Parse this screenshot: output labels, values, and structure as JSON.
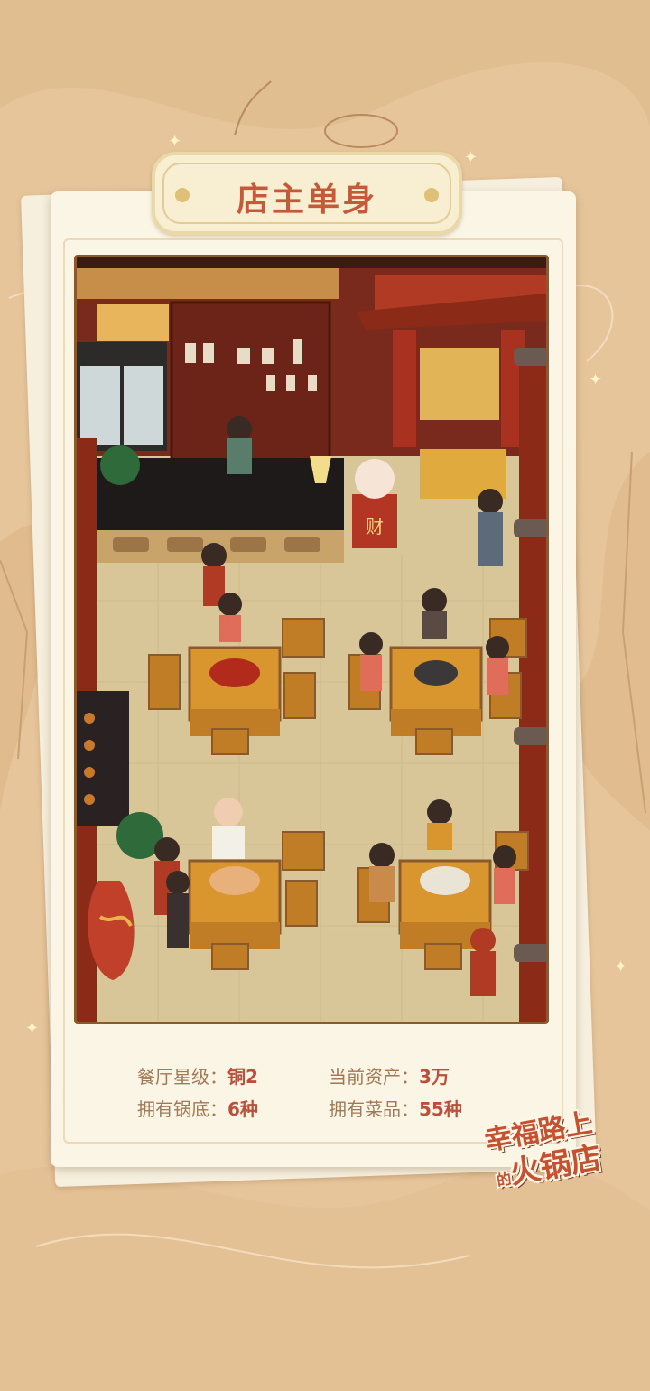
{
  "page": {
    "title": "店主单身"
  },
  "stats": {
    "star_label": "餐厅星级：",
    "star_value": "铜2",
    "assets_label": "当前资产：",
    "assets_value": "3万",
    "pots_label": "拥有锅底：",
    "pots_value": "6种",
    "dishes_label": "拥有菜品：",
    "dishes_value": "55种"
  },
  "logo": {
    "line1": "幸福路上",
    "small": "的",
    "line2": "火锅店"
  },
  "scene": {
    "cashier_sign": "财"
  },
  "colors": {
    "background": "#e9c9a0",
    "card": "#fbf5e6",
    "accent_red": "#c35b3b",
    "wood": "#8a5a2b",
    "floor": "#d9c79a"
  },
  "icons": [
    "lucky-cat-icon",
    "hotpot-icon",
    "bonsai-icon",
    "vase-icon",
    "lamp-icon"
  ]
}
